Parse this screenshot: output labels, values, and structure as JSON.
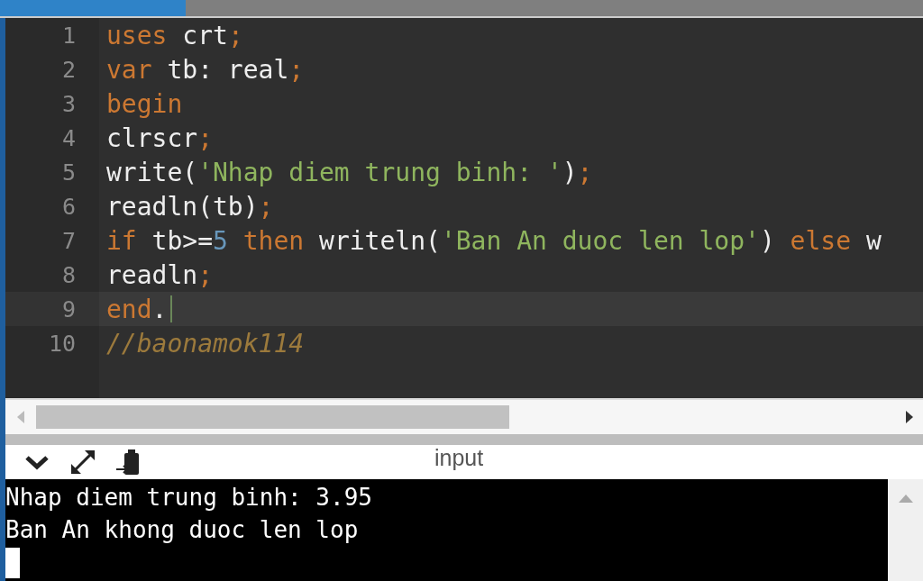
{
  "editor": {
    "lines": [
      {
        "number": "1",
        "active": false,
        "tokens": [
          {
            "kind": "keyword",
            "text": "uses"
          },
          {
            "kind": "plain",
            "text": " crt"
          },
          {
            "kind": "punct",
            "text": ";"
          }
        ]
      },
      {
        "number": "2",
        "active": false,
        "tokens": [
          {
            "kind": "keyword",
            "text": "var"
          },
          {
            "kind": "plain",
            "text": " tb: real"
          },
          {
            "kind": "punct",
            "text": ";"
          }
        ]
      },
      {
        "number": "3",
        "active": false,
        "tokens": [
          {
            "kind": "keyword",
            "text": "begin"
          }
        ]
      },
      {
        "number": "4",
        "active": false,
        "tokens": [
          {
            "kind": "plain",
            "text": "clrscr"
          },
          {
            "kind": "punct",
            "text": ";"
          }
        ]
      },
      {
        "number": "5",
        "active": false,
        "tokens": [
          {
            "kind": "plain",
            "text": "write("
          },
          {
            "kind": "string",
            "text": "'Nhap diem trung binh: '"
          },
          {
            "kind": "plain",
            "text": ")"
          },
          {
            "kind": "punct",
            "text": ";"
          }
        ]
      },
      {
        "number": "6",
        "active": false,
        "tokens": [
          {
            "kind": "plain",
            "text": "readln(tb)"
          },
          {
            "kind": "punct",
            "text": ";"
          }
        ]
      },
      {
        "number": "7",
        "active": false,
        "tokens": [
          {
            "kind": "keyword",
            "text": "if"
          },
          {
            "kind": "plain",
            "text": " tb>="
          },
          {
            "kind": "number",
            "text": "5"
          },
          {
            "kind": "keyword",
            "text": " then"
          },
          {
            "kind": "plain",
            "text": " writeln("
          },
          {
            "kind": "string",
            "text": "'Ban An duoc len lop'"
          },
          {
            "kind": "plain",
            "text": ")"
          },
          {
            "kind": "keyword",
            "text": " else"
          },
          {
            "kind": "plain",
            "text": " w"
          }
        ]
      },
      {
        "number": "8",
        "active": false,
        "tokens": [
          {
            "kind": "plain",
            "text": "readln"
          },
          {
            "kind": "punct",
            "text": ";"
          }
        ]
      },
      {
        "number": "9",
        "active": true,
        "tokens": [
          {
            "kind": "keyword",
            "text": "end"
          },
          {
            "kind": "plain",
            "text": "."
          }
        ]
      },
      {
        "number": "10",
        "active": false,
        "tokens": [
          {
            "kind": "comment",
            "text": "//baonamok114"
          }
        ]
      }
    ]
  },
  "console": {
    "title": "input",
    "lines": [
      "Nhap diem trung binh: 3.95",
      "Ban An khong duoc len lop"
    ]
  }
}
